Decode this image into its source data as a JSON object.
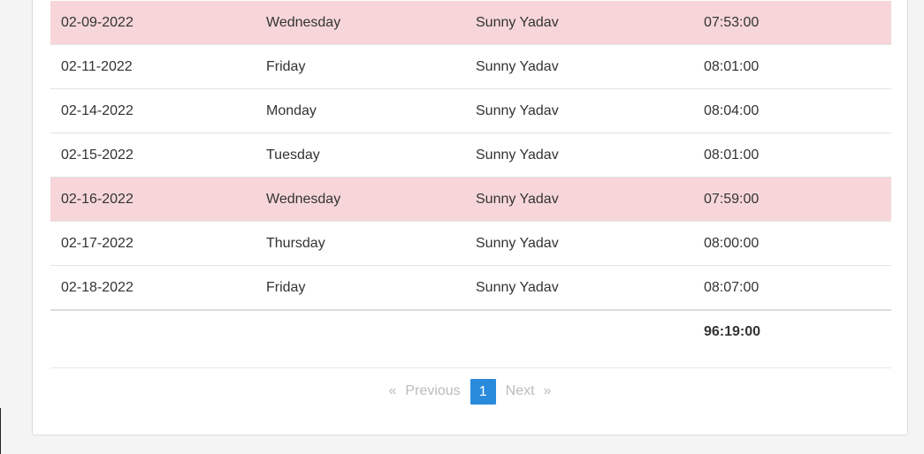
{
  "table": {
    "rows": [
      {
        "date": "02-09-2022",
        "day": "Wednesday",
        "name": "Sunny Yadav",
        "hours": "07:53:00",
        "highlight": true
      },
      {
        "date": "02-11-2022",
        "day": "Friday",
        "name": "Sunny Yadav",
        "hours": "08:01:00",
        "highlight": false
      },
      {
        "date": "02-14-2022",
        "day": "Monday",
        "name": "Sunny Yadav",
        "hours": "08:04:00",
        "highlight": false
      },
      {
        "date": "02-15-2022",
        "day": "Tuesday",
        "name": "Sunny Yadav",
        "hours": "08:01:00",
        "highlight": false
      },
      {
        "date": "02-16-2022",
        "day": "Wednesday",
        "name": "Sunny Yadav",
        "hours": "07:59:00",
        "highlight": true
      },
      {
        "date": "02-17-2022",
        "day": "Thursday",
        "name": "Sunny Yadav",
        "hours": "08:00:00",
        "highlight": false
      },
      {
        "date": "02-18-2022",
        "day": "Friday",
        "name": "Sunny Yadav",
        "hours": "08:07:00",
        "highlight": false
      }
    ],
    "total": "96:19:00"
  },
  "pagination": {
    "first_glyph": "«",
    "previous": "Previous",
    "current": "1",
    "next": "Next",
    "last_glyph": "»"
  },
  "colors": {
    "highlight_row": "#f7d6da",
    "active_page": "#2a8bdc"
  }
}
